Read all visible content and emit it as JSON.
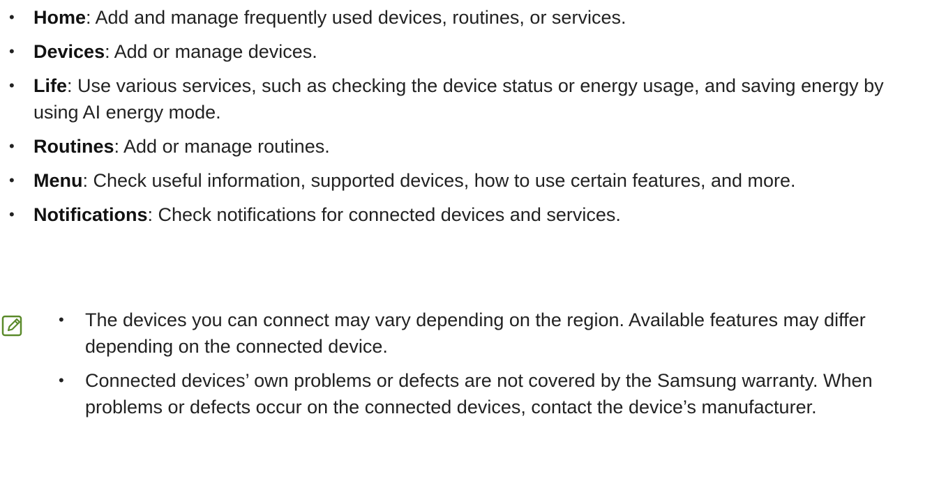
{
  "features": [
    {
      "term": "Home",
      "description": ": Add and manage frequently used devices, routines, or services."
    },
    {
      "term": "Devices",
      "description": ": Add or manage devices."
    },
    {
      "term": "Life",
      "description": ": Use various services, such as checking the device status or energy usage, and saving energy by using AI energy mode."
    },
    {
      "term": "Routines",
      "description": ": Add or manage routines."
    },
    {
      "term": "Menu",
      "description": ": Check useful information, supported devices, how to use certain features, and more."
    },
    {
      "term": "Notifications",
      "description": ": Check notifications for connected devices and services."
    }
  ],
  "note": {
    "icon": "note-pencil-icon",
    "icon_color": "#5a8a2a",
    "items": [
      "The devices you can connect may vary depending on the region. Available features may differ depending on the connected device.",
      "Connected devices’ own problems or defects are not covered by the Samsung warranty. When problems or defects occur on the connected devices, contact the device’s manufacturer."
    ]
  }
}
